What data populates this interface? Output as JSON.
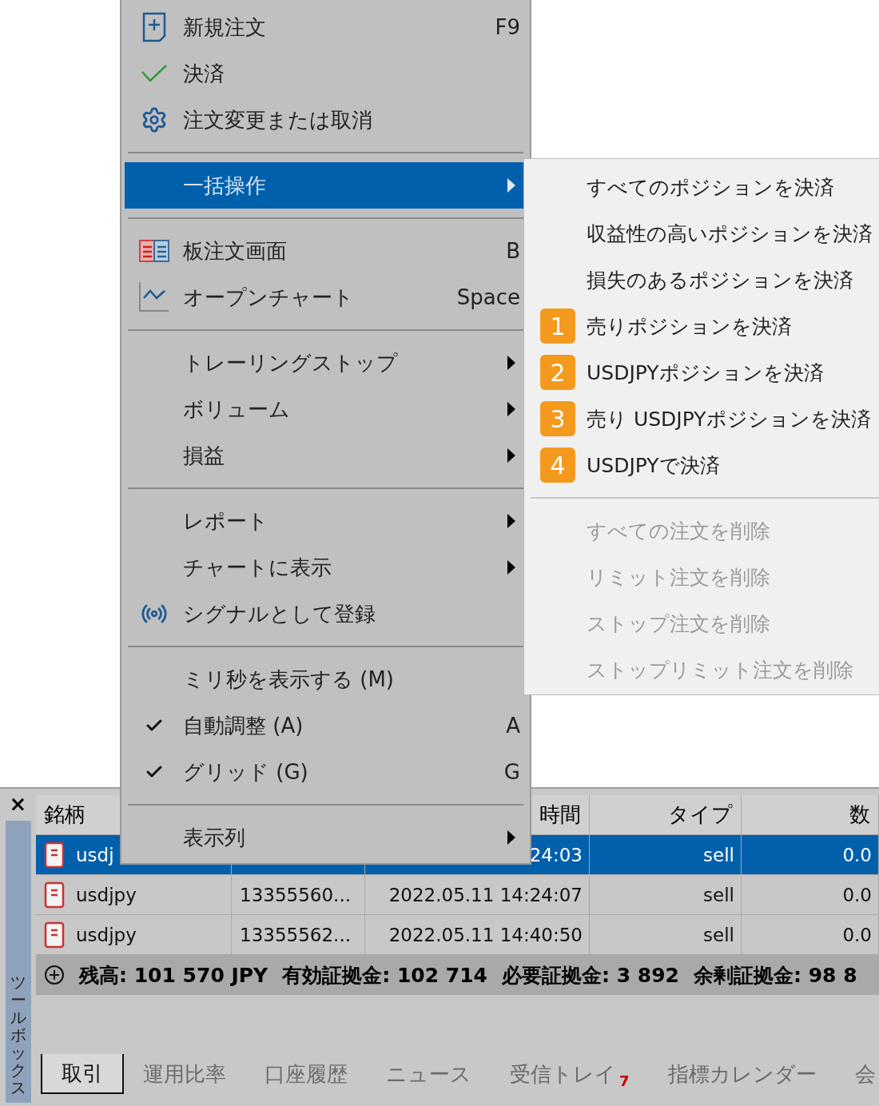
{
  "context_menu": {
    "items": [
      {
        "kind": "item",
        "label": "新規注文",
        "shortcut": "F9",
        "has_submenu": false,
        "selected": false,
        "checked": false
      },
      {
        "kind": "item",
        "label": "決済",
        "has_submenu": false,
        "selected": false,
        "checked": false
      },
      {
        "kind": "item",
        "label": "注文変更または取消",
        "has_submenu": false,
        "selected": false,
        "checked": false
      },
      {
        "kind": "separator"
      },
      {
        "kind": "item",
        "label": "一括操作",
        "has_submenu": true,
        "selected": true,
        "checked": false
      },
      {
        "kind": "separator"
      },
      {
        "kind": "item",
        "label": "板注文画面",
        "shortcut": "B",
        "has_submenu": false,
        "selected": false,
        "checked": false
      },
      {
        "kind": "item",
        "label": "オープンチャート",
        "shortcut": "Space",
        "has_submenu": false,
        "selected": false,
        "checked": false
      },
      {
        "kind": "separator"
      },
      {
        "kind": "item",
        "label": "トレーリングストップ",
        "has_submenu": true,
        "selected": false,
        "checked": false
      },
      {
        "kind": "item",
        "label": "ボリューム",
        "has_submenu": true,
        "selected": false,
        "checked": false
      },
      {
        "kind": "item",
        "label": "損益",
        "has_submenu": true,
        "selected": false,
        "checked": false
      },
      {
        "kind": "separator"
      },
      {
        "kind": "item",
        "label": "レポート",
        "has_submenu": true,
        "selected": false,
        "checked": false
      },
      {
        "kind": "item",
        "label": "チャートに表示",
        "has_submenu": true,
        "selected": false,
        "checked": false
      },
      {
        "kind": "item",
        "label": "シグナルとして登録",
        "has_submenu": false,
        "selected": false,
        "checked": false
      },
      {
        "kind": "separator"
      },
      {
        "kind": "item",
        "label": "ミリ秒を表示する (M)",
        "has_submenu": false,
        "selected": false,
        "checked": false
      },
      {
        "kind": "item",
        "label": "自動調整 (A)",
        "shortcut": "A",
        "has_submenu": false,
        "selected": false,
        "checked": true
      },
      {
        "kind": "item",
        "label": "グリッド (G)",
        "shortcut": "G",
        "has_submenu": false,
        "selected": false,
        "checked": true
      },
      {
        "kind": "separator"
      },
      {
        "kind": "item",
        "label": "表示列",
        "has_submenu": true,
        "selected": false,
        "checked": false
      }
    ]
  },
  "submenu": {
    "items": [
      {
        "kind": "item",
        "label": "すべてのポジションを決済",
        "disabled": false
      },
      {
        "kind": "item",
        "label": "収益性の高いポジションを決済",
        "disabled": false
      },
      {
        "kind": "item",
        "label": "損失のあるポジションを決済",
        "disabled": false
      },
      {
        "kind": "item",
        "label": "売りポジションを決済",
        "badge": "1",
        "disabled": false
      },
      {
        "kind": "item",
        "label": "USDJPYポジションを決済",
        "badge": "2",
        "disabled": false
      },
      {
        "kind": "item",
        "label": "売り USDJPYポジションを決済",
        "badge": "3",
        "disabled": false
      },
      {
        "kind": "item",
        "label": "USDJPYで決済",
        "badge": "4",
        "disabled": false
      },
      {
        "kind": "separator"
      },
      {
        "kind": "item",
        "label": "すべての注文を削除",
        "disabled": true
      },
      {
        "kind": "item",
        "label": "リミット注文を削除",
        "disabled": true
      },
      {
        "kind": "item",
        "label": "ストップ注文を削除",
        "disabled": true
      },
      {
        "kind": "item",
        "label": "ストップリミット注文を削除",
        "disabled": true
      }
    ]
  },
  "toolbox": {
    "close": "×",
    "title": "ツールボックス",
    "table": {
      "columns": [
        {
          "label": "銘柄"
        },
        {},
        {
          "label": "時間"
        },
        {
          "label": "タイプ"
        },
        {
          "label": "数"
        }
      ],
      "rows": [
        {
          "selected": true,
          "cells": [
            "usdj",
            null,
            "24:03",
            "sell",
            "0.0"
          ]
        },
        {
          "selected": false,
          "cells": [
            "usdjpy",
            "13355560...",
            "2022.05.11 14:24:07",
            "sell",
            "0.0"
          ]
        },
        {
          "selected": false,
          "cells": [
            "usdjpy",
            "13355562...",
            "2022.05.11 14:40:50",
            "sell",
            "0.0"
          ]
        }
      ]
    },
    "summary": [
      "残高: 101 570 JPY",
      "有効証拠金: 102 714",
      "必要証拠金: 3 892",
      "余剰証拠金: 98 8"
    ],
    "tabs": [
      {
        "label": "取引",
        "selected": true
      },
      {
        "label": "運用比率",
        "selected": false
      },
      {
        "label": "口座履歴",
        "selected": false
      },
      {
        "label": "ニュース",
        "selected": false
      },
      {
        "label": "受信トレイ",
        "badge": "7",
        "selected": false
      },
      {
        "label": "指標カレンダー",
        "selected": false
      },
      {
        "label": "会",
        "selected": false
      }
    ]
  }
}
